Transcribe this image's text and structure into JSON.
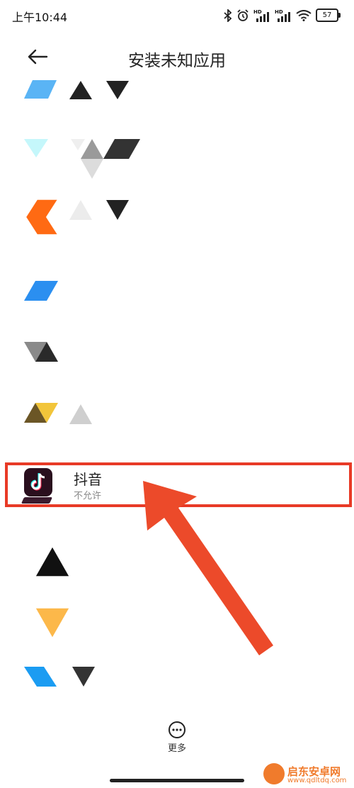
{
  "status_bar": {
    "time": "上午10:44",
    "hd_label": "HD",
    "battery": "57"
  },
  "header": {
    "title": "安装未知应用"
  },
  "highlighted_app": {
    "name": "抖音",
    "status": "不允许"
  },
  "bottom": {
    "more_label": "更多"
  },
  "watermark": {
    "name": "启东安卓网",
    "url": "www.qdltdq.com"
  },
  "colors": {
    "highlight": "#e83a26",
    "watermark": "#f07b2c"
  }
}
